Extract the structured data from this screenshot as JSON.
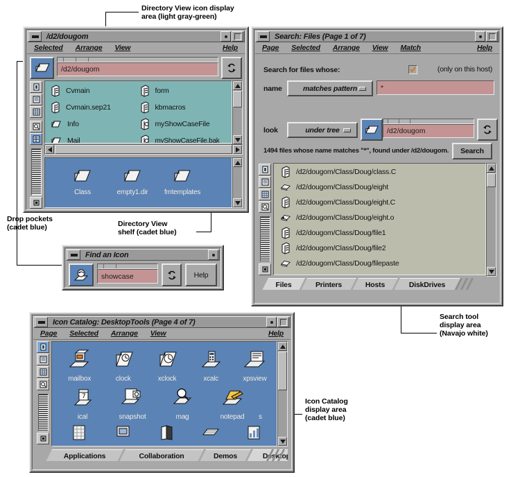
{
  "figure": {
    "annotations": [
      {
        "id": "ann-dirview-icon-area",
        "text": "Directory View icon display\narea (light gray-green)"
      },
      {
        "id": "ann-drop-pockets",
        "text": "Drop pockets\n(cadet blue)"
      },
      {
        "id": "ann-dirview-shelf",
        "text": "Directory View\nshelf (cadet blue)"
      },
      {
        "id": "ann-search-area",
        "text": "Search tool\ndisplay area\n(Navajo white)"
      },
      {
        "id": "ann-icon-catalog",
        "text": "Icon Catalog\ndisplay area\n(cadet blue)"
      }
    ]
  },
  "colors": {
    "window_gray": "#a8a8a8",
    "light_gray_green": "#7fb4b4",
    "cadet_blue": "#5b83b5",
    "navajo_white": "#bcbcad",
    "text_field_rose": "#c49494"
  },
  "dirview": {
    "title": "/d2/dougom",
    "menus": [
      "Selected",
      "Arrange",
      "View"
    ],
    "help_label": "Help",
    "path_value": "/d2/dougom",
    "toolbar_icons": [
      "folder-open-icon",
      "recycle-icon"
    ],
    "pocket_icons": [
      "dropsite-icon",
      "list-view-icon",
      "grid-view-icon",
      "find-icon",
      "detail-view-icon"
    ],
    "files": [
      {
        "name": "Cvmain",
        "icon": "binary-file-icon"
      },
      {
        "name": "form",
        "icon": "binary-file-icon"
      },
      {
        "name": "Cvmain.sep21",
        "icon": "binary-file-icon"
      },
      {
        "name": "kbmacros",
        "icon": "binary-file-icon"
      },
      {
        "name": "Info",
        "icon": "folder-icon"
      },
      {
        "name": "myShowCaseFile",
        "icon": "showcase-file-icon"
      },
      {
        "name": "Mail",
        "icon": "folder-icon"
      },
      {
        "name": "myShowCaseFile.bak",
        "icon": "showcase-file-icon"
      }
    ],
    "shelf_items": [
      {
        "name": "Class",
        "icon": "folder-icon"
      },
      {
        "name": "empty1.dir",
        "icon": "folder-icon"
      },
      {
        "name": "fmtemplates",
        "icon": "folder-icon"
      }
    ]
  },
  "search": {
    "title": "Search: Files (Page 1 of 7)",
    "menus": [
      "Page",
      "Selected",
      "Arrange",
      "View",
      "Match"
    ],
    "help_label": "Help",
    "prompt": "Search for files whose:",
    "host_checkbox_label": "(only on this host)",
    "host_checkbox_checked": "true",
    "name_label": "name",
    "name_option": "matches pattern",
    "name_value": "*",
    "look_label": "look",
    "look_option": "under tree",
    "look_value": "/d2/dougom",
    "status": "1494 files whose name matches \"*\", found under  /d2/dougom.",
    "search_button": "Search",
    "results": [
      {
        "path": "/d2/dougom/Class/Doug/class.C",
        "icon": "binary-file-icon"
      },
      {
        "path": "/d2/dougom/Class/Doug/eight",
        "icon": "generic-file-icon"
      },
      {
        "path": "/d2/dougom/Class/Doug/eight.C",
        "icon": "binary-file-icon"
      },
      {
        "path": "/d2/dougom/Class/Doug/eight.o",
        "icon": "object-file-icon"
      },
      {
        "path": "/d2/dougom/Class/Doug/file1",
        "icon": "binary-file-icon"
      },
      {
        "path": "/d2/dougom/Class/Doug/file2",
        "icon": "binary-file-icon"
      },
      {
        "path": "/d2/dougom/Class/Doug/filepaste",
        "icon": "generic-file-icon"
      }
    ],
    "tabs": [
      {
        "label": "Files",
        "active": "true"
      },
      {
        "label": "Printers",
        "active": "false"
      },
      {
        "label": "Hosts",
        "active": "false"
      },
      {
        "label": "DiskDrives",
        "active": "false"
      }
    ]
  },
  "findicon": {
    "title": "Find an Icon",
    "value": "showcase",
    "help_label": "Help",
    "pocket_icon": "showcase-icon",
    "recycle_icon": "recycle-icon"
  },
  "catalog": {
    "title": "Icon Catalog: DesktopTools (Page 4 of 7)",
    "menus": [
      "Page",
      "Selected",
      "Arrange",
      "View"
    ],
    "help_label": "Help",
    "pocket_icons": [
      "dropsite-icon",
      "list-view-icon",
      "grid-view-icon",
      "find-icon"
    ],
    "icons": [
      {
        "name": "mailbox",
        "icon": "mailbox-icon"
      },
      {
        "name": "clock",
        "icon": "clock-icon"
      },
      {
        "name": "xclock",
        "icon": "xclock-icon"
      },
      {
        "name": "xcalc",
        "icon": "calculator-icon"
      },
      {
        "name": "xpsview",
        "icon": "xpsview-icon"
      },
      {
        "name": "ical",
        "icon": "calendar-icon"
      },
      {
        "name": "snapshot",
        "icon": "snapshot-icon"
      },
      {
        "name": "mag",
        "icon": "magnifier-icon"
      },
      {
        "name": "notepad",
        "icon": "notepad-icon"
      },
      {
        "name": "s",
        "icon": "partial-icon"
      }
    ],
    "tabs": [
      {
        "label": "Applications",
        "active": "false"
      },
      {
        "label": "Collaboration",
        "active": "false"
      },
      {
        "label": "Demos",
        "active": "false"
      },
      {
        "label": "DesktopTools",
        "active": "true"
      }
    ]
  }
}
